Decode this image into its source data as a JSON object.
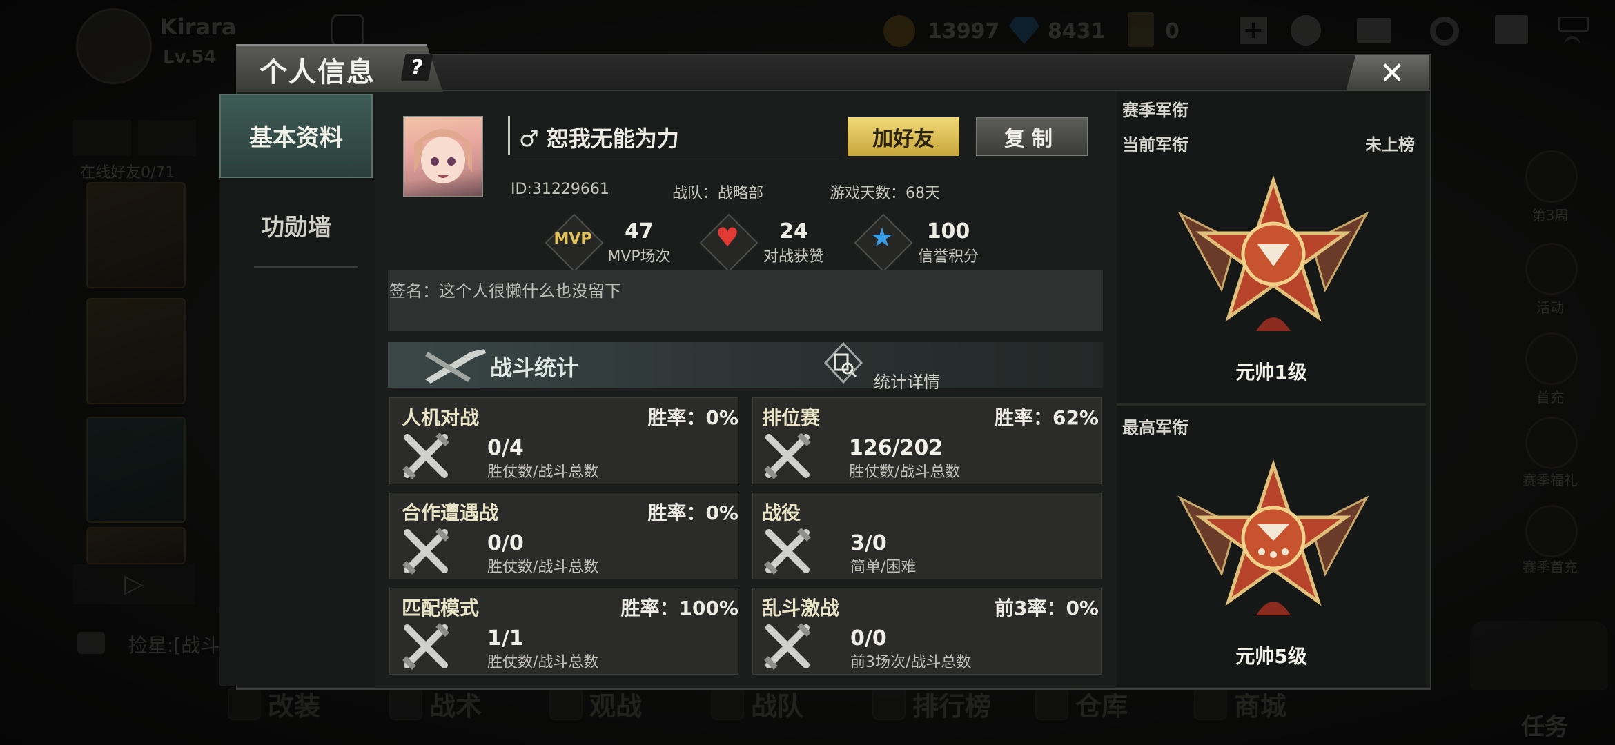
{
  "hud": {
    "player_name": "Kirara",
    "player_level": "Lv.54",
    "gold": "13997",
    "diamonds": "8431",
    "tickets": "0",
    "online_friends": "在线好友0/71",
    "chat_preview": "捡星:[战斗遥",
    "right_menu": [
      "第3周",
      "活动",
      "首充",
      "赛季福礼",
      "赛季首充"
    ],
    "task_label": "任务",
    "bottom_nav": [
      "改装",
      "战术",
      "观战",
      "战队",
      "排行榜",
      "仓库",
      "商城"
    ]
  },
  "modal": {
    "title": "个人信息",
    "help": "?",
    "close": "✕"
  },
  "nav": {
    "items": [
      {
        "label": "基本资料",
        "active": true
      },
      {
        "label": "功勋墙",
        "active": false
      }
    ]
  },
  "profile": {
    "gender_symbol": "♂",
    "name": "恕我无能为力",
    "add_friend_label": "加好友",
    "copy_label": "复制",
    "id_text": "ID:31229661",
    "team_text": "战队：战略部",
    "days_text": "游戏天数：68天",
    "signature": "签名：这个人很懒什么也没留下"
  },
  "stats": [
    {
      "icon": "mvp-icon",
      "badge": "MVP",
      "value": "47",
      "label": "MVP场次"
    },
    {
      "icon": "heart-icon",
      "badge": "♥",
      "value": "24",
      "label": "对战获赞"
    },
    {
      "icon": "star-icon",
      "badge": "★",
      "value": "100",
      "label": "信誉积分"
    }
  ],
  "battle": {
    "header": "战斗统计",
    "details_label": "统计详情",
    "modes": [
      {
        "title": "人机对战",
        "rate": "胜率：0%",
        "value": "0/4",
        "sub": "胜仗数/战斗总数"
      },
      {
        "title": "排位赛",
        "rate": "胜率：62%",
        "value": "126/202",
        "sub": "胜仗数/战斗总数"
      },
      {
        "title": "合作遭遇战",
        "rate": "胜率：0%",
        "value": "0/0",
        "sub": "胜仗数/战斗总数"
      },
      {
        "title": "战役",
        "rate": "",
        "value": "3/0",
        "sub": "简单/困难"
      },
      {
        "title": "匹配模式",
        "rate": "胜率：100%",
        "value": "1/1",
        "sub": "胜仗数/战斗总数"
      },
      {
        "title": "乱斗激战",
        "rate": "前3率：0%",
        "value": "0/0",
        "sub": "前3场次/战斗总数"
      }
    ]
  },
  "season": {
    "header": "赛季军衔",
    "current_label": "当前军衔",
    "current_status": "未上榜",
    "current_rank": "元帅1级",
    "best_label": "最高军衔",
    "best_rank": "元帅5级"
  },
  "colors": {
    "accent_gold": "#e3c35a",
    "nav_active": "#3e5b56",
    "medal_red": "#b8432b"
  }
}
